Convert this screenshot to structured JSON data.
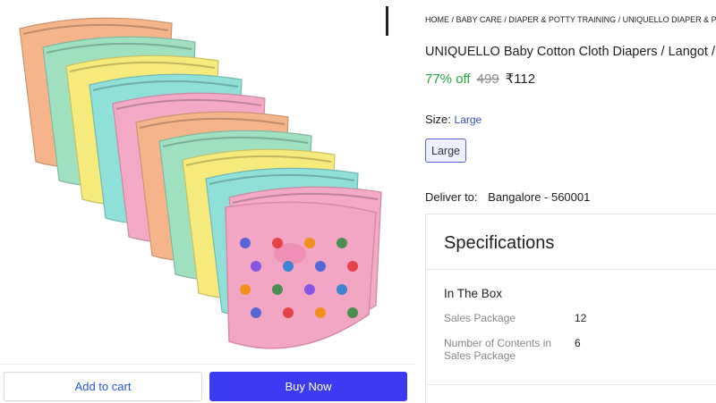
{
  "breadcrumb": [
    "HOME",
    "BABY CARE",
    "DIAPER & POTTY TRAINING",
    "UNIQUELLO DIAPER & POTTY TR"
  ],
  "product": {
    "title": "UNIQUELLO Baby Cotton Cloth Diapers / Langot / na",
    "discount": "77% off",
    "mrp": "499",
    "price": "₹112"
  },
  "size": {
    "label": "Size:",
    "selected": "Large",
    "options": [
      "Large"
    ]
  },
  "delivery": {
    "label": "Deliver to:",
    "location": "Bangalore - 560001"
  },
  "specifications": {
    "title": "Specifications",
    "group": "In The Box",
    "rows": [
      {
        "key": "Sales Package",
        "value": "12"
      },
      {
        "key": "Number of Contents in Sales Package",
        "value": "6"
      }
    ]
  },
  "actions": {
    "add_to_cart": "Add to cart",
    "buy_now": "Buy Now"
  },
  "colors": {
    "discount_green": "#26a541",
    "buy_button": "#3c3bf1",
    "cart_text": "#2a55e5",
    "diaper_colors": [
      "#f6b48a",
      "#9fe0c1",
      "#f6ea7c",
      "#8ee0d8",
      "#f4a9c6"
    ]
  }
}
